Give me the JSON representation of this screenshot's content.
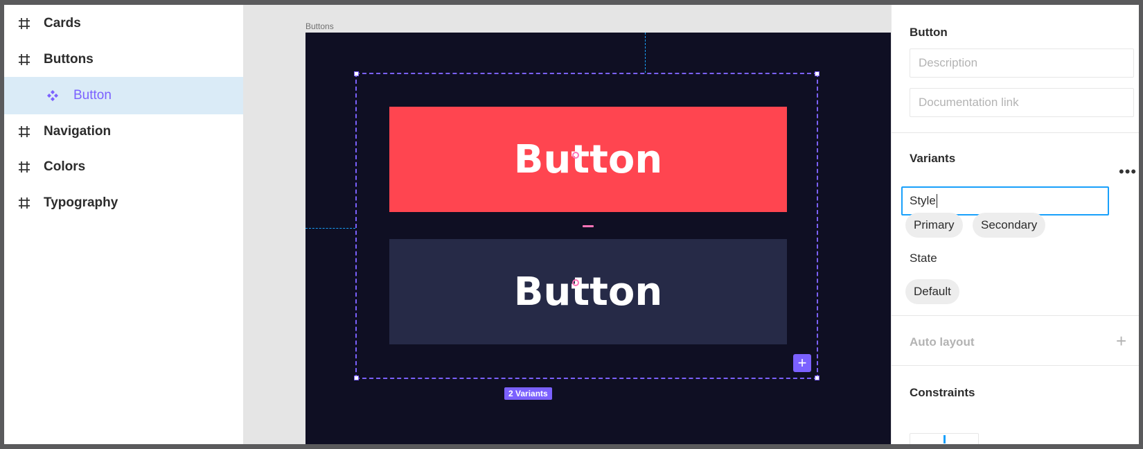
{
  "layers": [
    {
      "label": "Cards",
      "icon": "frame-hash-icon"
    },
    {
      "label": "Buttons",
      "icon": "frame-hash-icon"
    },
    {
      "label": "Button",
      "icon": "component-set-icon",
      "selected": true
    },
    {
      "label": "Navigation",
      "icon": "frame-hash-icon"
    },
    {
      "label": "Colors",
      "icon": "frame-hash-icon"
    },
    {
      "label": "Typography",
      "icon": "frame-hash-icon"
    }
  ],
  "canvas": {
    "frame_title": "Buttons",
    "primary_button_label": "Button",
    "secondary_button_label": "Button",
    "add_variant_label": "+",
    "variants_badge": "2 Variants"
  },
  "props": {
    "component_title": "Button",
    "description_placeholder": "Description",
    "documentation_placeholder": "Documentation link",
    "variants_title": "Variants",
    "more_label": "•••",
    "style_property_value": "Style",
    "style_values": [
      "Primary",
      "Secondary"
    ],
    "state_label": "State",
    "state_values": [
      "Default"
    ],
    "auto_layout_title": "Auto layout",
    "auto_layout_add": "+",
    "constraints_title": "Constraints"
  },
  "colors": {
    "accent": "#7b61ff",
    "selection_blue": "#18a0fb",
    "primary_button": "#ff4550",
    "secondary_button": "#262a47",
    "frame_background": "#0f0f23"
  }
}
